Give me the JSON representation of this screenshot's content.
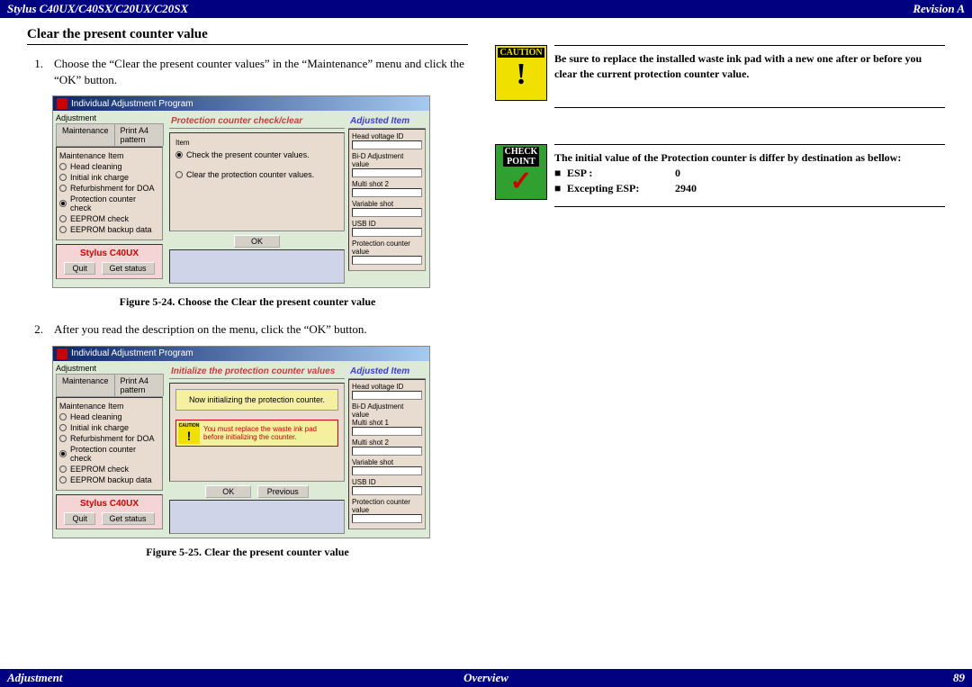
{
  "header": {
    "left": "Stylus C40UX/C40SX/C20UX/C20SX",
    "right": "Revision A"
  },
  "footer": {
    "left": "Adjustment",
    "center": "Overview",
    "right": "89"
  },
  "section_title": "Clear the present counter value",
  "steps": [
    {
      "num": "1.",
      "text": "Choose the “Clear the present counter values” in the “Maintenance” menu and click the “OK” button."
    },
    {
      "num": "2.",
      "text": "After you read the description on the menu, click the “OK” button."
    }
  ],
  "fig24_caption": "Figure 5-24.  Choose the Clear the present counter value",
  "fig25_caption": "Figure 5-25.  Clear the present counter value",
  "ss": {
    "title": "Individual Adjustment Program",
    "tab_adjust": "Adjustment",
    "tab_maint": "Maintenance",
    "tab_pattern": "Print A4 pattern",
    "group_label": "Maintenance Item",
    "items": [
      "Head cleaning",
      "Initial ink charge",
      "Refurbishment for DOA",
      "Protection counter check",
      "EEPROM check",
      "EEPROM backup data"
    ],
    "model": "Stylus C40UX",
    "btn_quit": "Quit",
    "btn_status": "Get status",
    "btn_ok": "OK",
    "btn_prev": "Previous",
    "center_title_24": "Protection counter check/clear",
    "item_label": "Item",
    "radio24a": "Check the present counter values.",
    "radio24b": "Clear the protection counter values.",
    "center_title_25": "Initialize the protection counter values",
    "msg25": "Now initializing the protection counter.",
    "caution_inline": "You must replace the waste ink pad before initializing the counter.",
    "caution_word": "CAUTION",
    "right_title": "Adjusted Item",
    "fields": [
      "Head voltage ID",
      "Bi-D Adjustment value",
      "Multi shot 1",
      "Multi shot 2",
      "Variable shot",
      "USB ID",
      "Protection counter value"
    ]
  },
  "caution_label": "CAUTION",
  "caution_text": "Be sure to replace the installed waste ink pad with a new one after or before you clear the current protection counter value.",
  "check_label1": "CHECK",
  "check_label2": "POINT",
  "check_intro": "The initial value of the Protection counter is differ by destination as bellow:",
  "check_rows": [
    {
      "label": "ESP :",
      "value": "0"
    },
    {
      "label": "Excepting ESP:",
      "value": "2940"
    }
  ]
}
